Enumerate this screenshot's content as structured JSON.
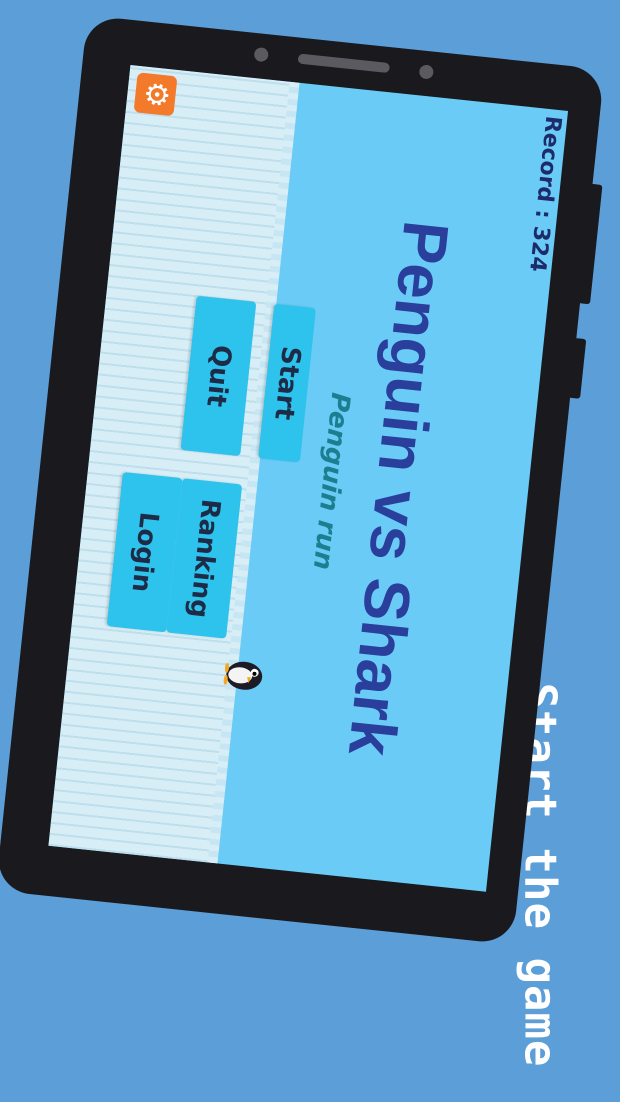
{
  "caption": "Start the game",
  "game": {
    "record_label": "Record : 324",
    "title": "Penguin vs Shark",
    "subtitle": "Penguin run",
    "settings_icon": "gear-icon",
    "buttons": {
      "start": "Start",
      "ranking": "Ranking",
      "quit": "Quit",
      "login": "Login"
    }
  },
  "colors": {
    "background": "#5b9ed8",
    "water": "#6accf6",
    "ice": "#d8eef7",
    "button": "#2ec3ec",
    "title": "#2a3e9c",
    "subtitle": "#1d7e90",
    "settings": "#f37a2a"
  }
}
